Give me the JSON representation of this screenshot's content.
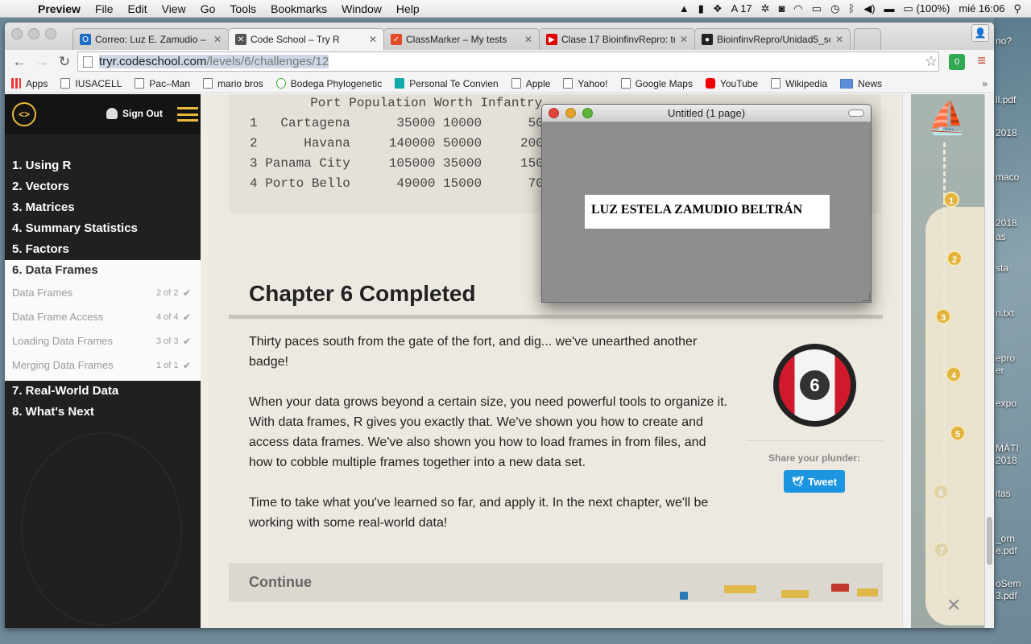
{
  "menubar": {
    "app_name": "Preview",
    "items": [
      "File",
      "Edit",
      "View",
      "Go",
      "Tools",
      "Bookmarks",
      "Window",
      "Help"
    ],
    "notification_count": "17",
    "battery": "(100%)",
    "clock": "mié 16:06"
  },
  "desktop": {
    "labels": [
      "no?",
      "ll.pdf",
      "2018",
      "maco",
      "2018",
      "as",
      "sta",
      "n.txt",
      "epro",
      "er",
      "expo",
      "MÁTI",
      "2018",
      "itas",
      "_orn",
      "e.pdf",
      "oSem",
      "3.pdf"
    ]
  },
  "browser": {
    "tabs": [
      {
        "label": "Correo: Luz E. Zamudio – (",
        "favicon": "outlook-icon",
        "color": "#1e6fc7"
      },
      {
        "label": "Code School – Try R",
        "favicon": "codeschool-icon",
        "color": "#555555"
      },
      {
        "label": "ClassMarker – My tests",
        "favicon": "classmarker-icon",
        "color": "#e24a2a"
      },
      {
        "label": "Clase 17 BioinfinvRepro: tr",
        "favicon": "youtube-icon",
        "color": "#e00000"
      },
      {
        "label": "BioinfinvRepro/Unidad5_sc",
        "favicon": "github-icon",
        "color": "#222222"
      }
    ],
    "url_host": "tryr.codeschool.com",
    "url_path": "/levels/6/challenges/12",
    "extension_badge": "0",
    "bookmarks": [
      {
        "label": "Apps",
        "icon": "apps-icon"
      },
      {
        "label": "IUSACELL",
        "icon": "page-icon"
      },
      {
        "label": "Pac–Man",
        "icon": "page-icon"
      },
      {
        "label": "mario bros",
        "icon": "page-icon"
      },
      {
        "label": "Bodega Phylogenetic",
        "icon": "phylo-icon"
      },
      {
        "label": "Personal Te Convien",
        "icon": "personal-icon"
      },
      {
        "label": "Apple",
        "icon": "page-icon"
      },
      {
        "label": "Yahoo!",
        "icon": "page-icon"
      },
      {
        "label": "Google Maps",
        "icon": "page-icon"
      },
      {
        "label": "YouTube",
        "icon": "youtube-icon"
      },
      {
        "label": "Wikipedia",
        "icon": "page-icon"
      },
      {
        "label": "News",
        "icon": "folder-icon"
      }
    ]
  },
  "sidebar": {
    "sign_out": "Sign Out",
    "chapters_before": [
      "1. Using R",
      "2. Vectors",
      "3. Matrices",
      "4. Summary Statistics",
      "5. Factors"
    ],
    "current_chapter": "6. Data Frames",
    "sections": [
      {
        "label": "Data Frames",
        "progress": "2 of 2"
      },
      {
        "label": "Data Frame Access",
        "progress": "4 of 4"
      },
      {
        "label": "Loading Data Frames",
        "progress": "3 of 3"
      },
      {
        "label": "Merging Data Frames",
        "progress": "1 of 1"
      }
    ],
    "chapters_after": [
      "7. Real-World Data",
      "8. What's Next"
    ]
  },
  "main": {
    "code_header": "  Port Population Worth Infantry",
    "code_rows": [
      "1   Cartagena      35000 10000      500",
      "2      Havana     140000 50000     2000",
      "3 Panama City     105000 35000     1500",
      "4 Porto Bello      49000 15000      700"
    ],
    "chapter_title": "Chapter 6 Completed",
    "paragraphs": [
      "Thirty paces south from the gate of the fort, and dig... we've unearthed another badge!",
      "When your data grows beyond a certain size, you need powerful tools to organize it. With data frames, R gives you exactly that. We've shown you how to create and access data frames. We've also shown you how to load frames in from files, and how to cobble multiple frames together into a new data set.",
      "Time to take what you've learned so far, and apply it. In the next chapter, we'll be working with some real-world data!"
    ],
    "badge_number": "6",
    "share_label": "Share your plunder:",
    "tweet_label": "Tweet",
    "continue_label": "Continue"
  },
  "map": {
    "nodes": [
      "1",
      "2",
      "3",
      "4",
      "5",
      "6",
      "7"
    ],
    "completed_count": 5
  },
  "preview_window": {
    "title": "Untitled (1 page)",
    "page_text": "LUZ ESTELA ZAMUDIO BELTRÁN"
  },
  "colors": {
    "accent_gold": "#e8b93c",
    "sidebar_bg": "#202020",
    "tweet_blue": "#1b95e0",
    "badge_red": "#d01a2b"
  }
}
